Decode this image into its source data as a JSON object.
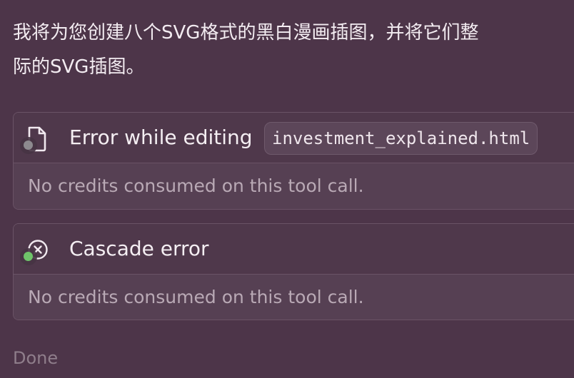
{
  "message": {
    "line1": "我将为您创建八个SVG格式的黑白漫画插图，并将它们整",
    "line2": "际的SVG插图。"
  },
  "cards": [
    {
      "icon": "file-icon",
      "status_color": "#8d8a8f",
      "title": "Error while editing",
      "file": "investment_explained.html",
      "body": "No credits consumed on this tool call."
    },
    {
      "icon": "circle-x-icon",
      "status_color": "#6fc46a",
      "title": "Cascade error",
      "body": "No credits consumed on this tool call."
    }
  ],
  "footer": {
    "status": "Done"
  }
}
